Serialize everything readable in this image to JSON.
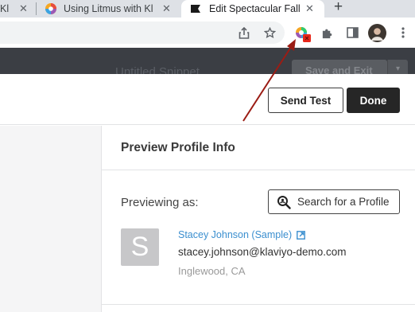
{
  "browser": {
    "tabs": [
      {
        "label": "Kl",
        "active": false
      },
      {
        "label": "Using Litmus with Kl",
        "active": false
      },
      {
        "label": "Edit Spectacular Fall",
        "active": true
      }
    ],
    "close_glyph": "✕",
    "new_tab_glyph": "+",
    "extension_badge_color": "#e8271b"
  },
  "app_header": {
    "title_ghost": "Untitled Snippet",
    "save_exit_label": "Save and Exit",
    "caret": "▾"
  },
  "actions": {
    "send_test_label": "Send Test",
    "done_label": "Done"
  },
  "preview": {
    "section_title": "Preview Profile Info",
    "previewing_label": "Previewing as:",
    "search_button_label": "Search for a Profile",
    "profile": {
      "avatar_initial": "S",
      "name": "Stacey Johnson (Sample)",
      "email": "stacey.johnson@klaviyo-demo.com",
      "location": "Inglewood, CA"
    }
  },
  "annotation": {
    "arrow_color": "#9b1c14"
  },
  "icons": [
    "share-icon",
    "star-icon",
    "litmus-extension-icon",
    "puzzle-icon",
    "sidepanel-icon",
    "user-avatar-icon",
    "kebab-menu-icon",
    "search-icon",
    "external-link-icon"
  ]
}
